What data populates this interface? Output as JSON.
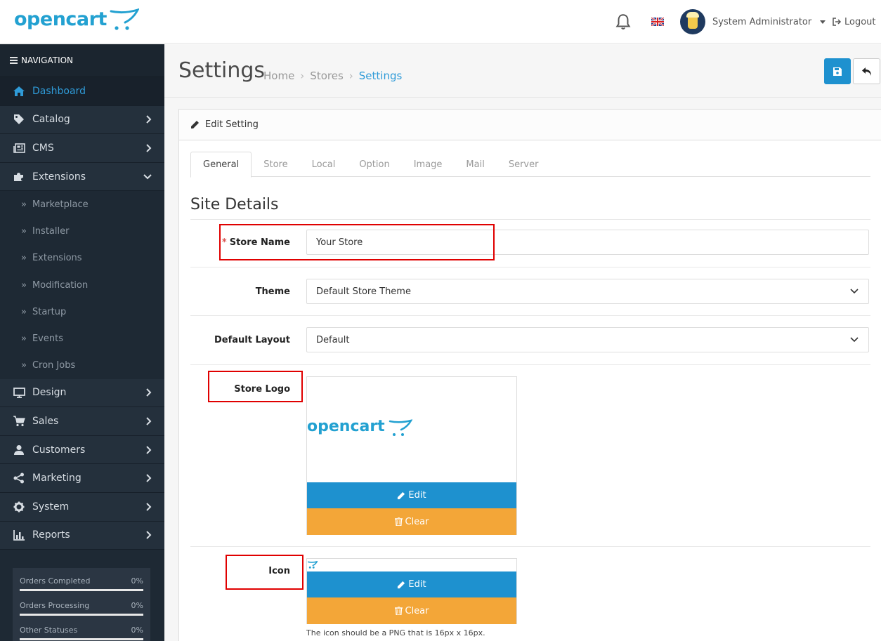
{
  "header": {
    "logo_text": "opencart",
    "user_name": "System Administrator",
    "logout_label": "Logout"
  },
  "sidebar": {
    "title": "NAVIGATION",
    "items": [
      {
        "label": "Dashboard",
        "icon": "home-icon"
      },
      {
        "label": "Catalog",
        "icon": "tag-icon"
      },
      {
        "label": "CMS",
        "icon": "newspaper-icon"
      },
      {
        "label": "Extensions",
        "icon": "puzzle-icon"
      }
    ],
    "extensions_sub": [
      "Marketplace",
      "Installer",
      "Extensions",
      "Modification",
      "Startup",
      "Events",
      "Cron Jobs"
    ],
    "items_after": [
      {
        "label": "Design",
        "icon": "monitor-icon"
      },
      {
        "label": "Sales",
        "icon": "cart-icon"
      },
      {
        "label": "Customers",
        "icon": "user-icon"
      },
      {
        "label": "Marketing",
        "icon": "share-icon"
      },
      {
        "label": "System",
        "icon": "gear-icon"
      },
      {
        "label": "Reports",
        "icon": "bar-chart-icon"
      }
    ],
    "stats": [
      {
        "label": "Orders Completed",
        "value": "0%"
      },
      {
        "label": "Orders Processing",
        "value": "0%"
      },
      {
        "label": "Other Statuses",
        "value": "0%"
      }
    ]
  },
  "page": {
    "title": "Settings",
    "breadcrumb": [
      "Home",
      "Stores",
      "Settings"
    ],
    "panel_title": "Edit Setting",
    "tabs": [
      "General",
      "Store",
      "Local",
      "Option",
      "Image",
      "Mail",
      "Server"
    ],
    "active_tab": "General",
    "section_title": "Site Details"
  },
  "form": {
    "store_name_label": "Store Name",
    "store_name_value": "Your Store",
    "theme_label": "Theme",
    "theme_value": "Default Store Theme",
    "layout_label": "Default Layout",
    "layout_value": "Default",
    "logo_label": "Store Logo",
    "logo_text": "opencart",
    "icon_label": "Icon",
    "edit_label": "Edit",
    "clear_label": "Clear",
    "icon_help": "The icon should be a PNG that is 16px x 16px."
  },
  "colors": {
    "brand": "#23a1d1",
    "primary": "#1e91cf",
    "warning": "#f3a638",
    "highlight": "#e00000",
    "sidebar_bg": "#1e2934"
  }
}
